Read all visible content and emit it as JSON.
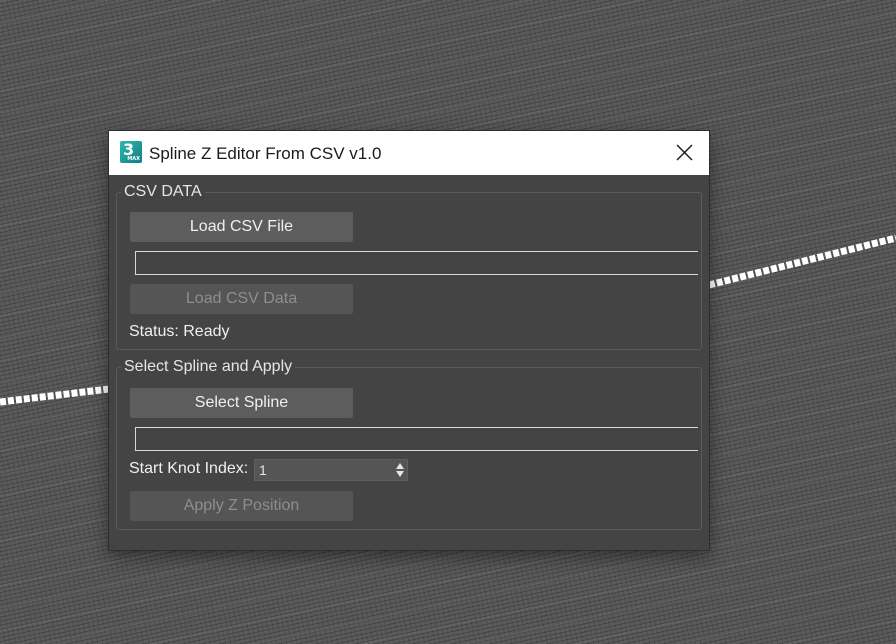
{
  "dialog": {
    "title": "Spline Z Editor From CSV v1.0",
    "icon": {
      "name": "3ds-max-app-icon",
      "glyph": "3",
      "sub": "MAX"
    },
    "close_icon": "close-icon"
  },
  "csv_group": {
    "label": "CSV DATA",
    "load_file_button": "Load CSV File",
    "file_path_value": "",
    "load_data_button": "Load CSV Data",
    "status_text": "Status: Ready"
  },
  "spline_group": {
    "label": "Select Spline and Apply",
    "select_button": "Select Spline",
    "selected_spline_value": "",
    "start_knot_label": "Start Knot Index:",
    "start_knot_value": "1",
    "apply_button": "Apply Z Position"
  },
  "colors": {
    "dialog_bg": "#444444",
    "titlebar_bg": "#ffffff",
    "button_bg": "#5d5d5d",
    "spline_color": "#ffffff"
  }
}
